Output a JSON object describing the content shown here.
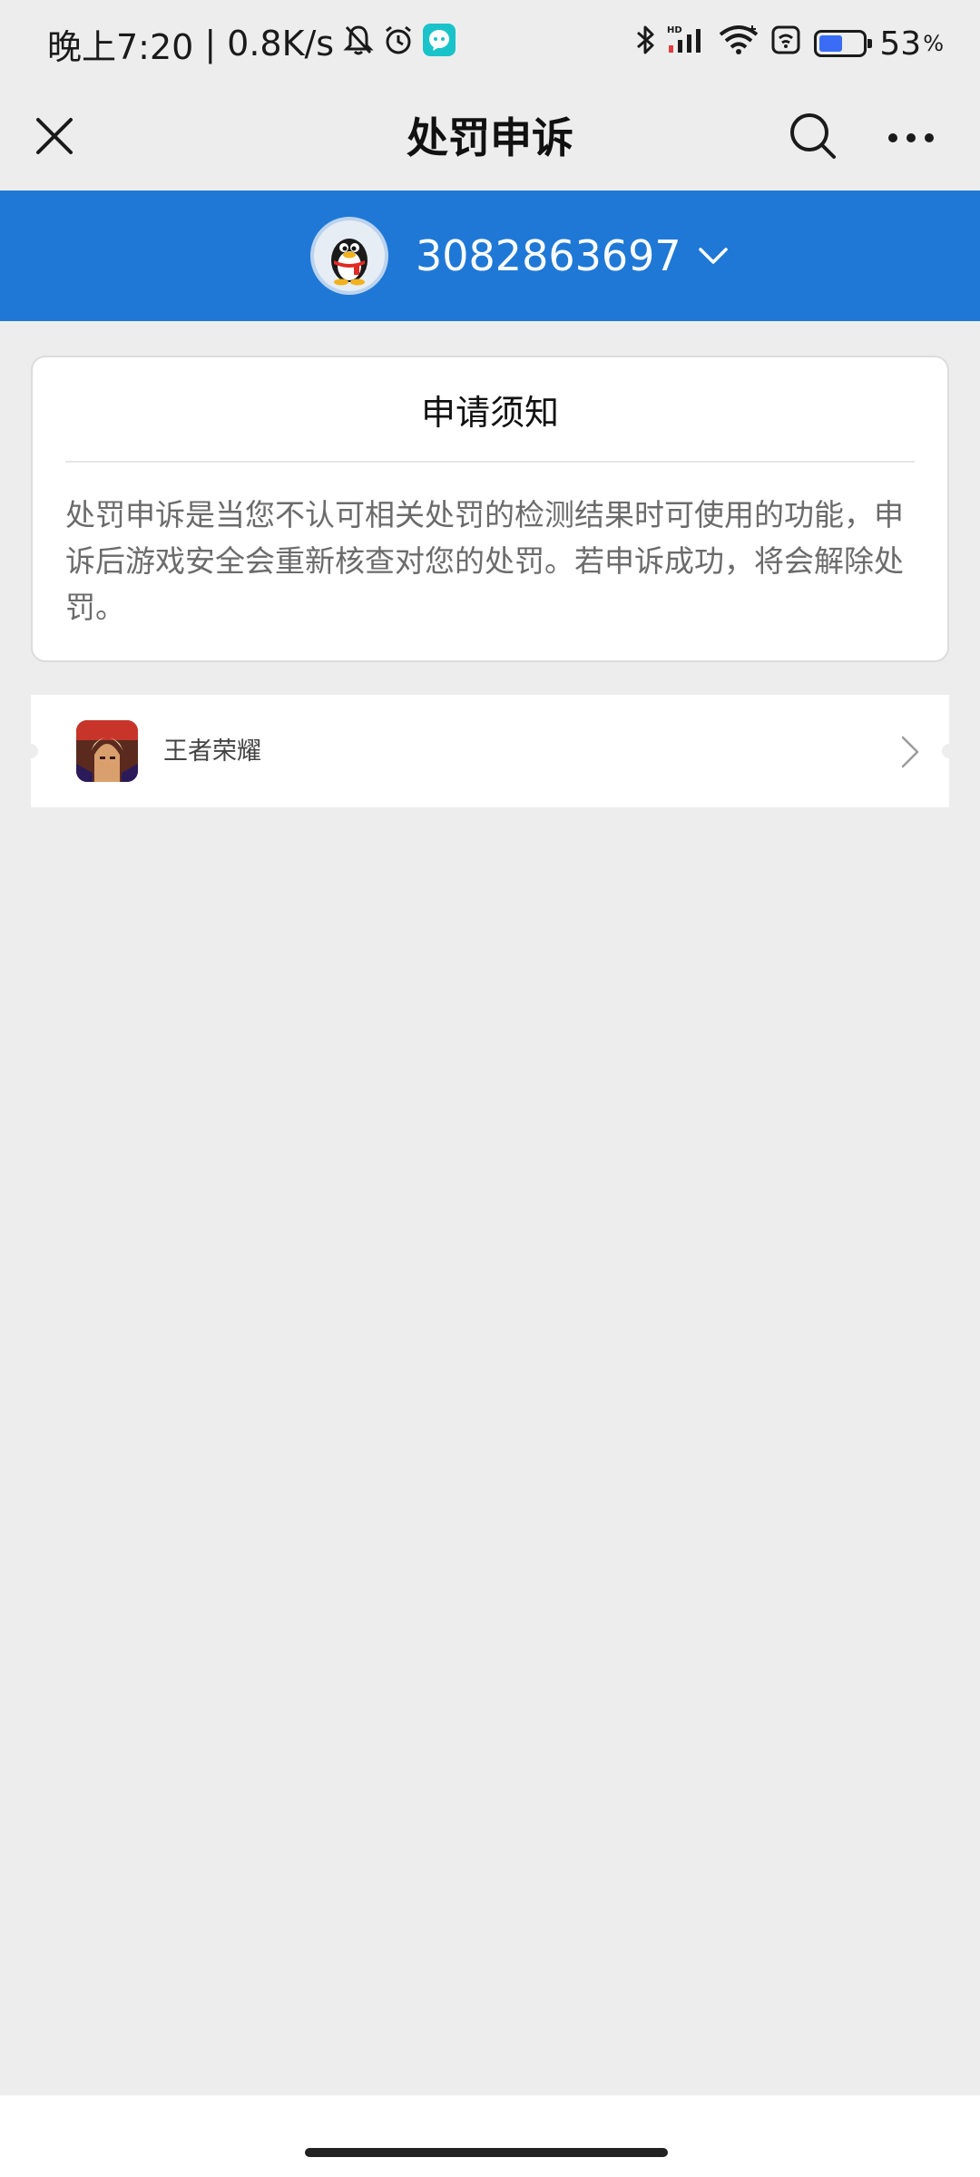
{
  "status_bar": {
    "time": "晚上7:20",
    "separator": "|",
    "net_speed": "0.8K/s",
    "battery_value": "53",
    "battery_unit": "%",
    "battery_level": 0.53,
    "icons": [
      "mute-icon",
      "alarm-icon",
      "chat-app-icon",
      "bluetooth-icon",
      "hd-signal-icon",
      "wifi-icon",
      "nfc-icon",
      "battery-icon"
    ]
  },
  "nav": {
    "title": "处罚申诉",
    "close_icon": "close-icon",
    "search_icon": "search-icon",
    "more_icon": "more-icon"
  },
  "account": {
    "id": "3082863697",
    "avatar_icon": "qq-penguin-avatar",
    "dropdown_icon": "chevron-down-icon"
  },
  "notice": {
    "title": "申请须知",
    "body": "处罚申诉是当您不认可相关处罚的检测结果时可使用的功能，申诉后游戏安全会重新核查对您的处罚。若申诉成功，将会解除处罚。"
  },
  "games": [
    {
      "name": "王者荣耀",
      "icon": "game-icon"
    }
  ],
  "colors": {
    "accent": "#1f78d6",
    "background": "#ededed",
    "card": "#ffffff",
    "title_text": "#111111",
    "body_text": "#6b6b6b"
  }
}
